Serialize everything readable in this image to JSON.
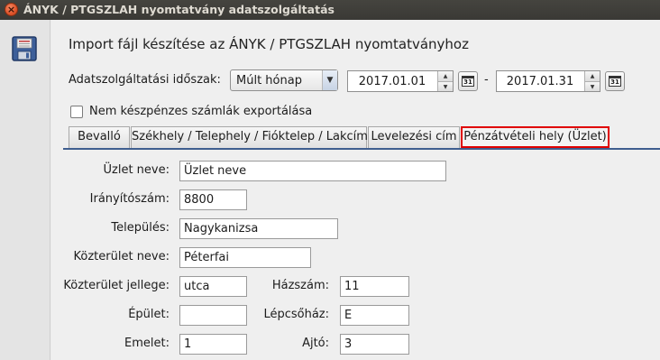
{
  "window": {
    "title": "ÁNYK / PTGSZLAH nyomtatvány adatszolgáltatás",
    "close_glyph": "×"
  },
  "heading": "Import fájl készítése az ÁNYK / PTGSZLAH nyomtatványhoz",
  "period": {
    "label": "Adatszolgáltatási időszak:",
    "preset": "Múlt hónap",
    "from": "2017.01.01",
    "separator": "-",
    "to": "2017.01.31",
    "calendar_glyph": "31"
  },
  "export_checkbox": {
    "label": "Nem készpénzes számlák exportálása",
    "checked": false
  },
  "tabs": [
    {
      "label": "Bevalló"
    },
    {
      "label": "Székhely / Telephely / Fióktelep / Lakcím"
    },
    {
      "label": "Levelezési cím"
    },
    {
      "label": "Pénzátvételi hely (Üzlet)"
    }
  ],
  "active_tab_index": 3,
  "form": {
    "shop_name": {
      "label": "Üzlet neve:",
      "value": "Üzlet neve"
    },
    "zip": {
      "label": "Irányítószám:",
      "value": "8800"
    },
    "city": {
      "label": "Település:",
      "value": "Nagykanizsa"
    },
    "street_name": {
      "label": "Közterület neve:",
      "value": "Péterfai"
    },
    "street_type": {
      "label": "Közterület jellege:",
      "value": "utca"
    },
    "house_number": {
      "label": "Házszám:",
      "value": "11"
    },
    "building": {
      "label": "Épület:",
      "value": ""
    },
    "staircase": {
      "label": "Lépcsőház:",
      "value": "E"
    },
    "floor": {
      "label": "Emelet:",
      "value": "1"
    },
    "door": {
      "label": "Ajtó:",
      "value": "3"
    }
  },
  "colors": {
    "active_tab_border": "#e00000",
    "tab_underline": "#3f5e8f",
    "titlebar": "#3c3b37"
  }
}
